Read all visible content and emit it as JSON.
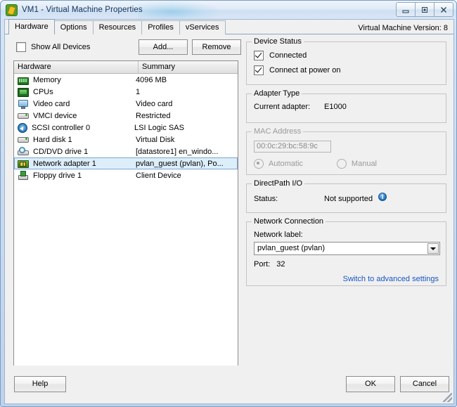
{
  "window": {
    "title": "VM1 - Virtual Machine Properties",
    "app_icon": "vm-properties-icon",
    "controls": {
      "minimize": "minimize-icon",
      "maximize": "maximize-icon",
      "close": "close-icon"
    }
  },
  "tabs": [
    {
      "label": "Hardware",
      "active": true
    },
    {
      "label": "Options",
      "active": false
    },
    {
      "label": "Resources",
      "active": false
    },
    {
      "label": "Profiles",
      "active": false
    },
    {
      "label": "vServices",
      "active": false
    }
  ],
  "vm_version": "Virtual Machine Version: 8",
  "toolbar": {
    "show_all_devices_label": "Show All Devices",
    "show_all_devices_checked": false,
    "add_label": "Add...",
    "remove_label": "Remove"
  },
  "hardware_list": {
    "columns": [
      "Hardware",
      "Summary"
    ],
    "rows": [
      {
        "icon": "memory-icon",
        "name": "Memory",
        "summary": "4096 MB",
        "selected": false
      },
      {
        "icon": "cpu-icon",
        "name": "CPUs",
        "summary": "1",
        "selected": false
      },
      {
        "icon": "video-card-icon",
        "name": "Video card",
        "summary": "Video card",
        "selected": false
      },
      {
        "icon": "vmci-device-icon",
        "name": "VMCI device",
        "summary": "Restricted",
        "selected": false
      },
      {
        "icon": "scsi-controller-icon",
        "name": "SCSI controller 0",
        "summary": "LSI Logic SAS",
        "selected": false
      },
      {
        "icon": "hard-disk-icon",
        "name": "Hard disk 1",
        "summary": "Virtual Disk",
        "selected": false
      },
      {
        "icon": "cd-dvd-drive-icon",
        "name": "CD/DVD drive 1",
        "summary": "[datastore1] en_windo...",
        "selected": false
      },
      {
        "icon": "network-adapter-icon",
        "name": "Network adapter 1",
        "summary": "pvlan_guest (pvlan), Po...",
        "selected": true
      },
      {
        "icon": "floppy-drive-icon",
        "name": "Floppy drive 1",
        "summary": "Client Device",
        "selected": false
      }
    ]
  },
  "device_status": {
    "legend": "Device Status",
    "connected_label": "Connected",
    "connected_checked": true,
    "connect_at_power_on_label": "Connect at power on",
    "connect_at_power_on_checked": true
  },
  "adapter_type": {
    "legend": "Adapter Type",
    "current_adapter_label": "Current adapter:",
    "current_adapter_value": "E1000"
  },
  "mac_address": {
    "legend": "MAC Address",
    "value": "00:0c:29:bc:58:9c",
    "automatic_label": "Automatic",
    "automatic_selected": true,
    "manual_label": "Manual",
    "manual_selected": false,
    "disabled": true
  },
  "directpath_io": {
    "legend": "DirectPath I/O",
    "status_label": "Status:",
    "status_value": "Not supported",
    "info_icon": "info-icon"
  },
  "network_connection": {
    "legend": "Network Connection",
    "network_label_caption": "Network label:",
    "network_label_value": "pvlan_guest (pvlan)",
    "port_label": "Port:",
    "port_value": "32",
    "advanced_link": "Switch to advanced settings"
  },
  "footer": {
    "help_label": "Help",
    "ok_label": "OK",
    "cancel_label": "Cancel"
  },
  "colors": {
    "selection_fill": "#ddeefb",
    "selection_border": "#7aa7d0",
    "link": "#1757c4",
    "title_text": "#10325c",
    "window_chrome": "#cadcf0"
  }
}
